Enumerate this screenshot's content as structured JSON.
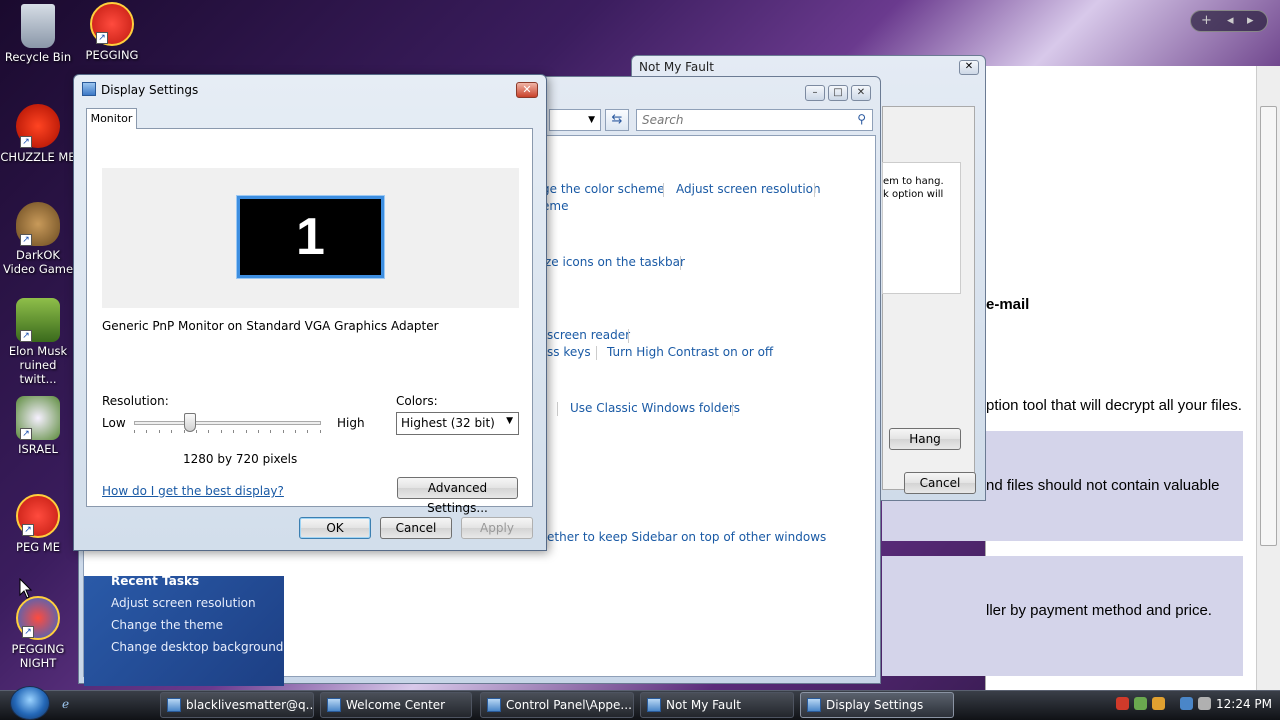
{
  "desktop": {
    "icons": [
      {
        "label": "Recycle Bin"
      },
      {
        "label": "PEGGING"
      },
      {
        "label": "CHUZZLE ME"
      },
      {
        "label": "DarkOK\nVideo Game"
      },
      {
        "label": "Elon Musk\nruined twitt..."
      },
      {
        "label": "ISRAEL"
      },
      {
        "label": "PEG ME"
      },
      {
        "label": "PEGGING\nNIGHT"
      }
    ]
  },
  "appearance_window": {
    "search_placeholder": "Search",
    "links": [
      "ge the color scheme",
      "Adjust screen resolution",
      "eme",
      "ze icons on the taskbar",
      "screen reader",
      "ss keys",
      "Turn High Contrast on or off",
      "Use Classic Windows folders",
      "ether to keep Sidebar on top of other windows"
    ],
    "recent_tasks": {
      "heading": "Recent Tasks",
      "items": [
        "Adjust screen resolution",
        "Change the theme",
        "Change desktop background"
      ]
    }
  },
  "not_my_fault_window": {
    "title": "Not My Fault",
    "text_line1": "em to hang.",
    "text_line2": "k option will",
    "hang_button": "Hang",
    "cancel_button": "Cancel"
  },
  "background_page": {
    "heading": "e-mail",
    "line1": "ption tool that will decrypt all your files.",
    "line2": "nd files should not contain valuable",
    "line3": "ller by payment method and price."
  },
  "display_settings": {
    "title": "Display Settings",
    "tab": "Monitor",
    "monitor_number": "1",
    "adapter": "Generic PnP Monitor on Standard VGA Graphics Adapter",
    "resolution_label": "Resolution:",
    "low_label": "Low",
    "high_label": "High",
    "resolution_value": "1280 by 720 pixels",
    "resolution_slider_level": 0.3,
    "colors_label": "Colors:",
    "colors_value": "Highest (32 bit)",
    "help_link": "How do I get the best display?",
    "advanced_button": "Advanced Settings...",
    "ok_button": "OK",
    "cancel_button": "Cancel",
    "apply_button": "Apply"
  },
  "taskbar": {
    "buttons": [
      {
        "label": "blacklivesmatter@q..."
      },
      {
        "label": "Welcome Center"
      },
      {
        "label": "Control Panel\\Appe..."
      },
      {
        "label": "Not My Fault"
      },
      {
        "label": "Display Settings"
      }
    ],
    "clock": "12:24 PM"
  },
  "colors": {
    "link": "#1a5aa5",
    "focus_blue": "#3d8ee0",
    "lavender": "#d4d4ea"
  }
}
